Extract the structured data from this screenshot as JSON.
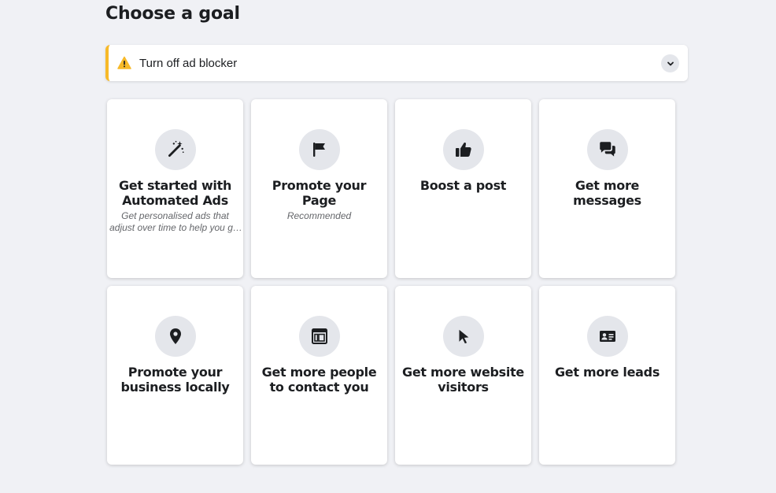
{
  "page": {
    "title": "Choose a goal"
  },
  "alert": {
    "text": "Turn off ad blocker",
    "accent_color": "#f7b928"
  },
  "goals": [
    {
      "title": "Get started with Automated Ads",
      "subtitle": "Get personalised ads that adjust over time to help you get better results",
      "icon": "magic-wand-icon"
    },
    {
      "title": "Promote your Page",
      "subtitle": "Recommended",
      "icon": "flag-icon"
    },
    {
      "title": "Boost a post",
      "subtitle": "",
      "icon": "thumbs-up-icon"
    },
    {
      "title": "Get more messages",
      "subtitle": "",
      "icon": "chat-bubbles-icon"
    },
    {
      "title": "Promote your business locally",
      "subtitle": "",
      "icon": "location-pin-icon"
    },
    {
      "title": "Get more people to contact you",
      "subtitle": "",
      "icon": "contact-page-icon"
    },
    {
      "title": "Get more website visitors",
      "subtitle": "",
      "icon": "cursor-icon"
    },
    {
      "title": "Get more leads",
      "subtitle": "",
      "icon": "id-card-icon"
    }
  ]
}
